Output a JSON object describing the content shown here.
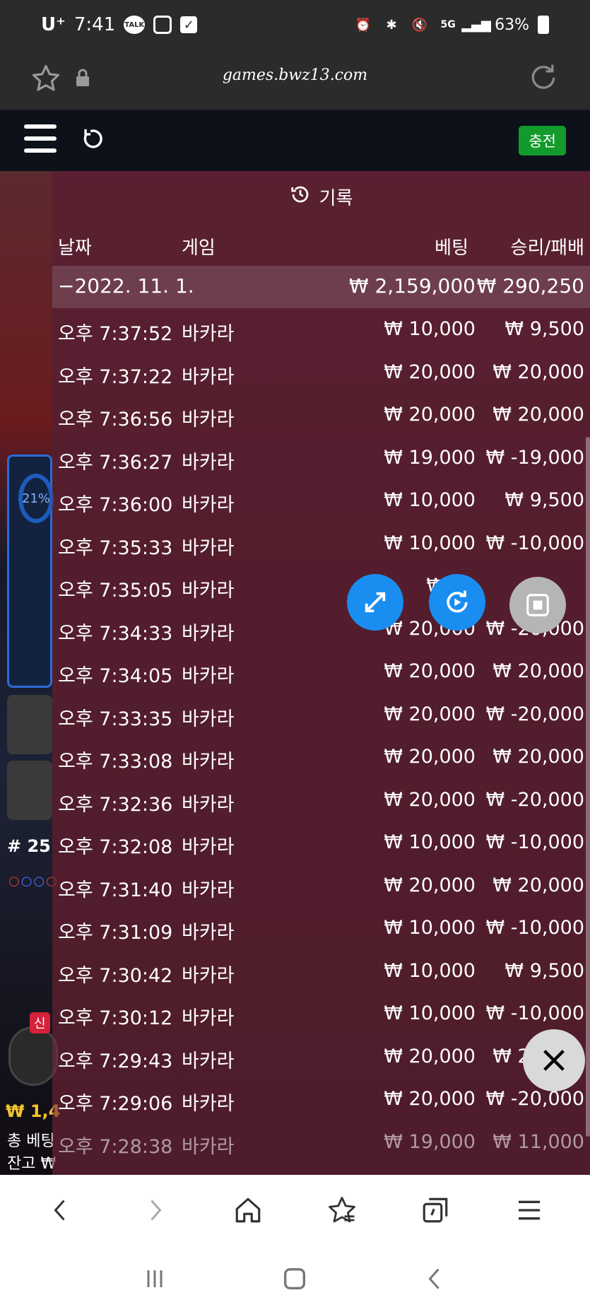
{
  "status_bar": {
    "carrier": "U⁺",
    "time": "7:41",
    "talk_label": "TALK",
    "network": "5G",
    "battery": "63%"
  },
  "browser": {
    "url": "games.bwz13.com"
  },
  "app_header": {
    "charge_label": "충전"
  },
  "history": {
    "title": "기록",
    "columns": {
      "date": "날짜",
      "game": "게임",
      "bet": "베팅",
      "result": "승리/패배"
    },
    "day": {
      "date": "−2022. 11. 1.",
      "bet": "₩ 2,159,000",
      "result": "₩ 290,250"
    },
    "rows": [
      {
        "time": "오후 7:37:52",
        "game": "바카라",
        "bet": "₩ 10,000",
        "result": "₩ 9,500"
      },
      {
        "time": "오후 7:37:22",
        "game": "바카라",
        "bet": "₩ 20,000",
        "result": "₩ 20,000"
      },
      {
        "time": "오후 7:36:56",
        "game": "바카라",
        "bet": "₩ 20,000",
        "result": "₩ 20,000"
      },
      {
        "time": "오후 7:36:27",
        "game": "바카라",
        "bet": "₩ 19,000",
        "result": "₩ -19,000"
      },
      {
        "time": "오후 7:36:00",
        "game": "바카라",
        "bet": "₩ 10,000",
        "result": "₩ 9,500"
      },
      {
        "time": "오후 7:35:33",
        "game": "바카라",
        "bet": "₩ 10,000",
        "result": "₩ -10,000"
      },
      {
        "time": "오후 7:35:05",
        "game": "바카라",
        "bet": "₩ 10",
        "result": ""
      },
      {
        "time": "오후 7:34:33",
        "game": "바카라",
        "bet": "₩ 20,000",
        "result": "₩ -20,000"
      },
      {
        "time": "오후 7:34:05",
        "game": "바카라",
        "bet": "₩ 20,000",
        "result": "₩ 20,000"
      },
      {
        "time": "오후 7:33:35",
        "game": "바카라",
        "bet": "₩ 20,000",
        "result": "₩ -20,000"
      },
      {
        "time": "오후 7:33:08",
        "game": "바카라",
        "bet": "₩ 20,000",
        "result": "₩ 20,000"
      },
      {
        "time": "오후 7:32:36",
        "game": "바카라",
        "bet": "₩ 20,000",
        "result": "₩ -20,000"
      },
      {
        "time": "오후 7:32:08",
        "game": "바카라",
        "bet": "₩ 10,000",
        "result": "₩ -10,000"
      },
      {
        "time": "오후 7:31:40",
        "game": "바카라",
        "bet": "₩ 20,000",
        "result": "₩ 20,000"
      },
      {
        "time": "오후 7:31:09",
        "game": "바카라",
        "bet": "₩ 10,000",
        "result": "₩ -10,000"
      },
      {
        "time": "오후 7:30:42",
        "game": "바카라",
        "bet": "₩ 10,000",
        "result": "₩ 9,500"
      },
      {
        "time": "오후 7:30:12",
        "game": "바카라",
        "bet": "₩ 10,000",
        "result": "₩ -10,000"
      },
      {
        "time": "오후 7:29:43",
        "game": "바카라",
        "bet": "₩ 20,000",
        "result": "₩ 20,000"
      },
      {
        "time": "오후 7:29:06",
        "game": "바카라",
        "bet": "₩ 20,000",
        "result": "₩ -20,000"
      },
      {
        "time": "오후 7:28:38",
        "game": "바카라",
        "bet": "₩ 19,000",
        "result": "₩ 11,000"
      }
    ]
  },
  "left_panel": {
    "percent": "21%",
    "round": "# 25",
    "new_badge": "신",
    "money": "₩ 1,4",
    "total_bet_label": "총 베팅",
    "balance_label": "잔고 ₩"
  },
  "colors": {
    "accent_blue": "#1a8df0",
    "charge_green": "#129a2b",
    "overlay": "#6e283c"
  }
}
